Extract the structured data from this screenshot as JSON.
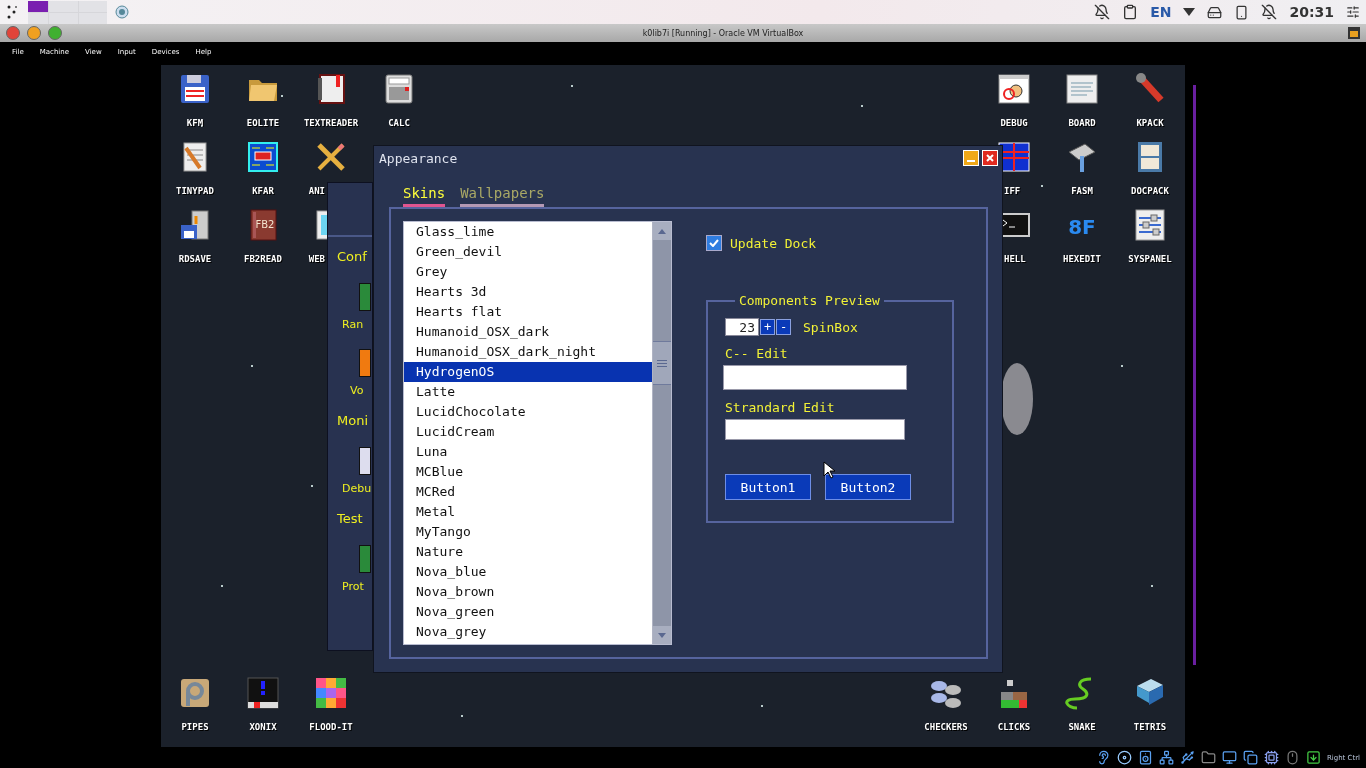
{
  "host_panel": {
    "workspaces": [
      {
        "selected": true
      },
      {
        "selected": false
      },
      {
        "selected": false
      },
      {
        "selected": false
      },
      {
        "selected": false
      },
      {
        "selected": false
      }
    ],
    "language": "EN",
    "clock": "20:31"
  },
  "vm_window": {
    "title": "k0lib7i [Running] - Oracle VM VirtualBox",
    "menu": [
      "File",
      "Machine",
      "View",
      "Input",
      "Devices",
      "Help"
    ],
    "host_key": "Right Ctrl"
  },
  "desktop": {
    "top_left": [
      [
        {
          "label": "KFM",
          "kind": "floppy"
        },
        {
          "label": "EOLITE",
          "kind": "folder"
        },
        {
          "label": "TEXTREADER",
          "kind": "notebook"
        },
        {
          "label": "CALC",
          "kind": "calculator"
        }
      ],
      [
        {
          "label": "TINYPAD",
          "kind": "notepad"
        },
        {
          "label": "KFAR",
          "kind": "screen"
        },
        {
          "label": "ANI",
          "kind": "ruler"
        }
      ],
      [
        {
          "label": "RDSAVE",
          "kind": "computer"
        },
        {
          "label": "FB2READ",
          "kind": "redbook",
          "glyph": "FB2"
        },
        {
          "label": "WEB",
          "kind": "monitor"
        }
      ]
    ],
    "top_right": [
      [
        {
          "label": "DEBUG",
          "kind": "bug"
        },
        {
          "label": "BOARD",
          "kind": "document"
        },
        {
          "label": "KPACK",
          "kind": "wrench"
        }
      ],
      [
        {
          "label": "IFF",
          "kind": "spreadsheet"
        },
        {
          "label": "FASM",
          "kind": "hammer"
        },
        {
          "label": "DOCPACK",
          "kind": "cabinet"
        }
      ],
      [
        {
          "label": "HELL",
          "kind": "terminal"
        },
        {
          "label": "HEXEDIT",
          "kind": "lettering",
          "glyph": "8F"
        },
        {
          "label": "SYSPANEL",
          "kind": "sliders"
        }
      ]
    ],
    "bottom_left": [
      [
        {
          "label": "PIPES",
          "kind": "pipe"
        },
        {
          "label": "XONIX",
          "kind": "column"
        },
        {
          "label": "FLOOD-IT",
          "kind": "mosaic"
        }
      ]
    ],
    "bottom_right": [
      [
        {
          "label": "CHECKERS",
          "kind": "discs"
        },
        {
          "label": "CLICKS",
          "kind": "blocks"
        },
        {
          "label": "SNAKE",
          "kind": "snake"
        },
        {
          "label": "TETRIS",
          "kind": "cubes"
        }
      ]
    ]
  },
  "back_window": {
    "rows": [
      {
        "kind": "heading",
        "label": "Conf"
      },
      {
        "kind": "item",
        "label": "Ran"
      },
      {
        "kind": "item",
        "label": "Vo"
      },
      {
        "kind": "heading",
        "label": "Moni"
      },
      {
        "kind": "item",
        "label": "Debu"
      },
      {
        "kind": "heading",
        "label": "Test"
      },
      {
        "kind": "item",
        "label": "Prot"
      }
    ]
  },
  "appearance": {
    "title": "Appearance",
    "tabs": [
      {
        "label": "Skins",
        "selected": true
      },
      {
        "label": "Wallpapers",
        "selected": false
      }
    ],
    "skins": [
      {
        "label": "Glass_lime",
        "selected": false
      },
      {
        "label": "Green_devil",
        "selected": false
      },
      {
        "label": "Grey",
        "selected": false
      },
      {
        "label": "Hearts 3d",
        "selected": false
      },
      {
        "label": "Hearts flat",
        "selected": false
      },
      {
        "label": "Humanoid_OSX_dark",
        "selected": false
      },
      {
        "label": "Humanoid_OSX_dark_night",
        "selected": false
      },
      {
        "label": "HydrogenOS",
        "selected": true
      },
      {
        "label": "Latte",
        "selected": false
      },
      {
        "label": "LucidChocolate",
        "selected": false
      },
      {
        "label": "LucidCream",
        "selected": false
      },
      {
        "label": "Luna",
        "selected": false
      },
      {
        "label": "MCBlue",
        "selected": false
      },
      {
        "label": "MCRed",
        "selected": false
      },
      {
        "label": "Metal",
        "selected": false
      },
      {
        "label": "MyTango",
        "selected": false
      },
      {
        "label": "Nature",
        "selected": false
      },
      {
        "label": "Nova_blue",
        "selected": false
      },
      {
        "label": "Nova_brown",
        "selected": false
      },
      {
        "label": "Nova_green",
        "selected": false
      },
      {
        "label": "Nova_grey",
        "selected": false
      }
    ],
    "update_dock": {
      "label": "Update Dock",
      "checked": true
    },
    "preview": {
      "title": "Components Preview",
      "spin_value": "23",
      "spin_buttons": [
        "+",
        "-"
      ],
      "spin_label": "SpinBox",
      "cminus_label": "C-- Edit",
      "standard_label": "Strandard Edit",
      "buttons": [
        "Button1",
        "Button2"
      ]
    }
  }
}
